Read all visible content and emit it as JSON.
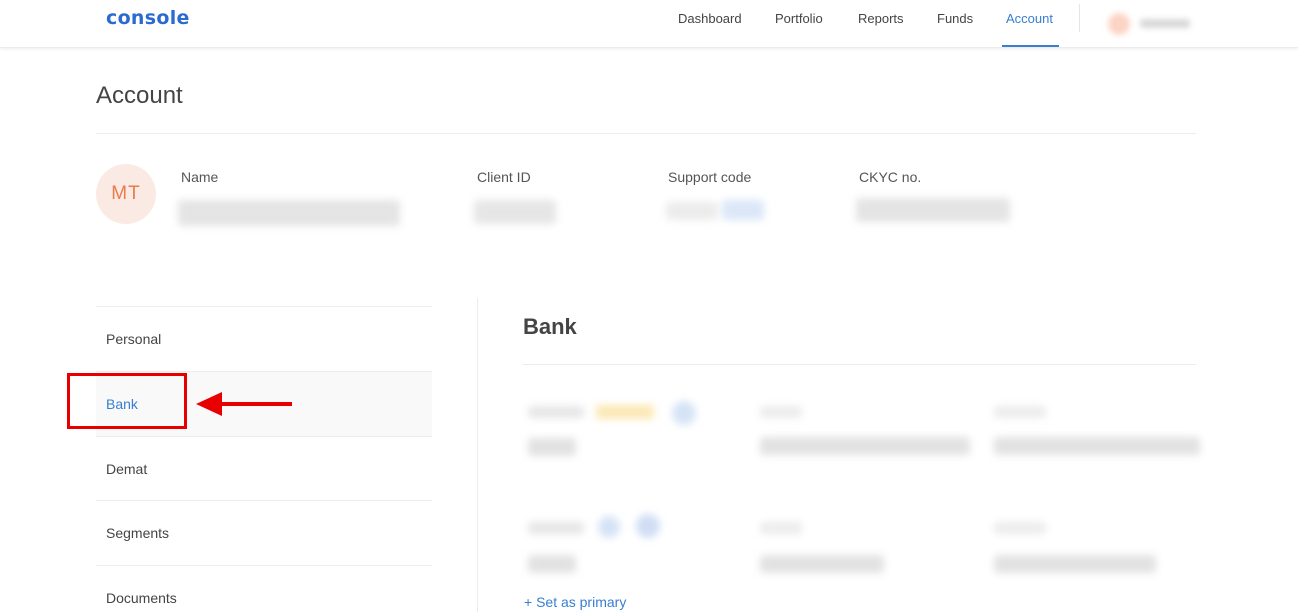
{
  "header": {
    "logo": "console",
    "nav": [
      "Dashboard",
      "Portfolio",
      "Reports",
      "Funds",
      "Account"
    ],
    "active_nav": "Account"
  },
  "page": {
    "title": "Account"
  },
  "profile": {
    "initials": "MT",
    "fields": [
      "Name",
      "Client ID",
      "Support code",
      "CKYC no."
    ]
  },
  "menu": {
    "items": [
      "Personal",
      "Bank",
      "Demat",
      "Segments",
      "Documents"
    ],
    "active": "Bank"
  },
  "bank": {
    "title": "Bank",
    "set_primary": "+ Set as primary"
  },
  "colors": {
    "accent": "#387ed1",
    "annotation": "#e80000",
    "avatar_bg": "#fbe9e3",
    "avatar_text": "#e97c4f"
  }
}
